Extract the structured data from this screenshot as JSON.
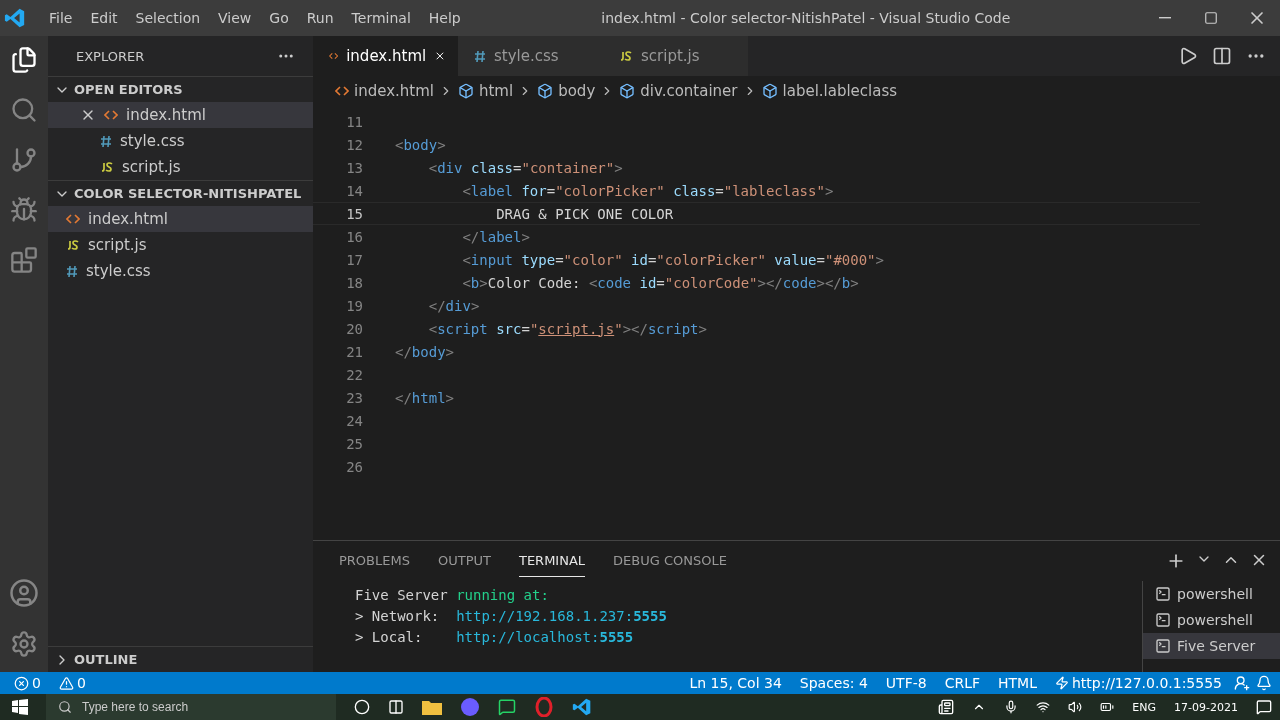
{
  "window": {
    "title": "index.html - Color selector-NitishPatel - Visual Studio Code"
  },
  "menu": [
    "File",
    "Edit",
    "Selection",
    "View",
    "Go",
    "Run",
    "Terminal",
    "Help"
  ],
  "sidebar": {
    "title": "EXPLORER",
    "sections": [
      {
        "title": "OPEN EDITORS",
        "expanded": true,
        "items": [
          {
            "name": "index.html",
            "kind": "html",
            "selected": true
          },
          {
            "name": "style.css",
            "kind": "css",
            "selected": false
          },
          {
            "name": "script.js",
            "kind": "js",
            "selected": false
          }
        ]
      },
      {
        "title": "COLOR SELECTOR-NITISHPATEL",
        "expanded": true,
        "items": [
          {
            "name": "index.html",
            "kind": "html",
            "selected": true
          },
          {
            "name": "script.js",
            "kind": "js",
            "selected": false
          },
          {
            "name": "style.css",
            "kind": "css",
            "selected": false
          }
        ]
      }
    ],
    "outline": {
      "title": "OUTLINE",
      "expanded": false
    }
  },
  "tabs": [
    {
      "label": "index.html",
      "kind": "html",
      "selected": true
    },
    {
      "label": "style.css",
      "kind": "css",
      "selected": false
    },
    {
      "label": "script.js",
      "kind": "js",
      "selected": false
    }
  ],
  "breadcrumb": [
    {
      "label": "index.html",
      "kind": "html"
    },
    {
      "label": "html",
      "kind": "element"
    },
    {
      "label": "body",
      "kind": "element"
    },
    {
      "label": "div.container",
      "kind": "element"
    },
    {
      "label": "label.lableclass",
      "kind": "element"
    }
  ],
  "code": [
    {
      "number": "11",
      "current": false
    },
    {
      "number": "12",
      "current": false,
      "tokens": [
        {
          "text": "<",
          "kind": "punct"
        },
        {
          "text": "body",
          "kind": "tag"
        },
        {
          "text": ">",
          "kind": "punct"
        }
      ]
    },
    {
      "number": "13",
      "current": false,
      "tokens": [
        {
          "text": "    <",
          "kind": "punct"
        },
        {
          "text": "div",
          "kind": "tag"
        },
        {
          "text": " class",
          "kind": "attr"
        },
        {
          "text": "=",
          "kind": "text"
        },
        {
          "text": "\"container\"",
          "kind": "string"
        },
        {
          "text": ">",
          "kind": "punct"
        }
      ]
    },
    {
      "number": "14",
      "current": false,
      "tokens": [
        {
          "text": "        <",
          "kind": "punct"
        },
        {
          "text": "label",
          "kind": "tag"
        },
        {
          "text": " for",
          "kind": "attr"
        },
        {
          "text": "=",
          "kind": "text"
        },
        {
          "text": "\"colorPicker\"",
          "kind": "string"
        },
        {
          "text": " class",
          "kind": "attr"
        },
        {
          "text": "=",
          "kind": "text"
        },
        {
          "text": "\"lableclass\"",
          "kind": "string"
        },
        {
          "text": ">",
          "kind": "punct"
        }
      ]
    },
    {
      "number": "15",
      "current": true,
      "tokens": [
        {
          "text": "            DRAG & PICK ONE COLOR",
          "kind": "text"
        }
      ]
    },
    {
      "number": "16",
      "current": false,
      "tokens": [
        {
          "text": "        </",
          "kind": "punct"
        },
        {
          "text": "label",
          "kind": "tag"
        },
        {
          "text": ">",
          "kind": "punct"
        }
      ]
    },
    {
      "number": "17",
      "current": false,
      "tokens": [
        {
          "text": "        <",
          "kind": "punct"
        },
        {
          "text": "input",
          "kind": "tag"
        },
        {
          "text": " type",
          "kind": "attr"
        },
        {
          "text": "=",
          "kind": "text"
        },
        {
          "text": "\"color\"",
          "kind": "string"
        },
        {
          "text": " id",
          "kind": "attr"
        },
        {
          "text": "=",
          "kind": "text"
        },
        {
          "text": "\"colorPicker\"",
          "kind": "string"
        },
        {
          "text": " value",
          "kind": "attr"
        },
        {
          "text": "=",
          "kind": "text"
        },
        {
          "text": "\"#000\"",
          "kind": "string"
        },
        {
          "text": ">",
          "kind": "punct"
        }
      ]
    },
    {
      "number": "18",
      "current": false,
      "tokens": [
        {
          "text": "        <",
          "kind": "punct"
        },
        {
          "text": "b",
          "kind": "tag"
        },
        {
          "text": ">",
          "kind": "punct"
        },
        {
          "text": "Color Code: ",
          "kind": "text"
        },
        {
          "text": "<",
          "kind": "punct"
        },
        {
          "text": "code",
          "kind": "tag"
        },
        {
          "text": " id",
          "kind": "attr"
        },
        {
          "text": "=",
          "kind": "text"
        },
        {
          "text": "\"colorCode\"",
          "kind": "string"
        },
        {
          "text": "></",
          "kind": "punct"
        },
        {
          "text": "code",
          "kind": "tag"
        },
        {
          "text": "></",
          "kind": "punct"
        },
        {
          "text": "b",
          "kind": "tag"
        },
        {
          "text": ">",
          "kind": "punct"
        }
      ]
    },
    {
      "number": "19",
      "current": false,
      "tokens": [
        {
          "text": "    </",
          "kind": "punct"
        },
        {
          "text": "div",
          "kind": "tag"
        },
        {
          "text": ">",
          "kind": "punct"
        }
      ]
    },
    {
      "number": "20",
      "current": false,
      "tokens": [
        {
          "text": "    <",
          "kind": "punct"
        },
        {
          "text": "script",
          "kind": "tag"
        },
        {
          "text": " src",
          "kind": "attr"
        },
        {
          "text": "=",
          "kind": "text"
        },
        {
          "text": "\"",
          "kind": "string"
        },
        {
          "text": "script.js",
          "kind": "link"
        },
        {
          "text": "\"",
          "kind": "string"
        },
        {
          "text": "></",
          "kind": "punct"
        },
        {
          "text": "script",
          "kind": "tag"
        },
        {
          "text": ">",
          "kind": "punct"
        }
      ]
    },
    {
      "number": "21",
      "current": false,
      "tokens": [
        {
          "text": "</",
          "kind": "punct"
        },
        {
          "text": "body",
          "kind": "tag"
        },
        {
          "text": ">",
          "kind": "punct"
        }
      ]
    },
    {
      "number": "22",
      "current": false
    },
    {
      "number": "23",
      "current": false,
      "tokens": [
        {
          "text": "</",
          "kind": "punct"
        },
        {
          "text": "html",
          "kind": "tag"
        },
        {
          "text": ">",
          "kind": "punct"
        }
      ]
    },
    {
      "number": "24",
      "current": false
    },
    {
      "number": "25",
      "current": false
    },
    {
      "number": "26",
      "current": false
    }
  ],
  "panel": {
    "tabs": [
      {
        "label": "PROBLEMS",
        "selected": false
      },
      {
        "label": "OUTPUT",
        "selected": false
      },
      {
        "label": "TERMINAL",
        "selected": true
      },
      {
        "label": "DEBUG CONSOLE",
        "selected": false
      }
    ],
    "terminal": [
      [
        {
          "text": "Five Server ",
          "kind": "text"
        },
        {
          "text": "running at:",
          "kind": "green"
        }
      ],
      [
        {
          "text": "> Network:  ",
          "kind": "text"
        },
        {
          "text": "http://192.168.1.237:",
          "kind": "url"
        },
        {
          "text": "5555",
          "kind": "port"
        }
      ],
      [
        {
          "text": "> Local:    ",
          "kind": "text"
        },
        {
          "text": "http://localhost:",
          "kind": "url"
        },
        {
          "text": "5555",
          "kind": "port"
        }
      ]
    ],
    "terminals": [
      {
        "label": "powershell",
        "selected": false
      },
      {
        "label": "powershell",
        "selected": false
      },
      {
        "label": "Five Server",
        "selected": true
      }
    ]
  },
  "status_bar": {
    "errors": "0",
    "warnings": "0",
    "items": [
      "Ln 15, Col 34",
      "Spaces: 4",
      "UTF-8",
      "CRLF",
      "HTML"
    ],
    "server": "http://127.0.0.1:5555"
  },
  "taskbar": {
    "search_placeholder": "Type here to search",
    "language": "ENG",
    "date": "17-09-2021"
  }
}
